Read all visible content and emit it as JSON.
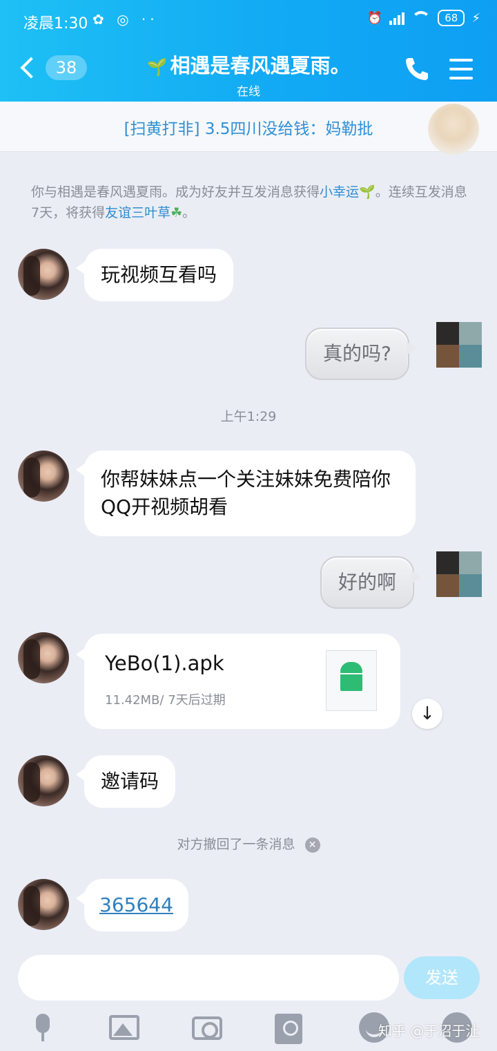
{
  "status_bar": {
    "time": "凌晨1:30",
    "left_icons": "✿ ◎ ··",
    "battery": "68",
    "charging": "⚡"
  },
  "header": {
    "back_count": "38",
    "title_icon": "🌱",
    "title": "相遇是春风遇夏雨。",
    "subtitle": "在线"
  },
  "banner": {
    "text": "[扫黄打非] 3.5四川没给钱：妈勒批"
  },
  "system_notice": {
    "part1": "你与相遇是春风遇夏雨。成为好友并互发消息获得",
    "link1": "小幸运",
    "icon1": "🌱",
    "part2": "。连续互发消息7天，将获得",
    "link2": "友谊三叶草",
    "icon2": "☘",
    "part3": "。"
  },
  "messages": [
    {
      "from": "other",
      "text": "玩视频互看吗"
    },
    {
      "from": "self",
      "text": "真的吗?"
    },
    {
      "from": "time",
      "text": "上午1:29"
    },
    {
      "from": "other",
      "text": "你帮妹妹点一个关注妹妹免费陪你QQ开视频胡看"
    },
    {
      "from": "self",
      "text": "好的啊"
    },
    {
      "from": "other",
      "type": "file",
      "file_name": "YeBo(1).apk",
      "file_meta": "11.42MB/ 7天后过期"
    },
    {
      "from": "other",
      "text": "邀请码"
    },
    {
      "from": "system",
      "text": "对方撤回了一条消息"
    },
    {
      "from": "other",
      "text": "365644"
    }
  ],
  "input": {
    "placeholder": "",
    "send_label": "发送"
  },
  "watermark": "知乎 @于沼于沚",
  "colors": {
    "header_start": "#1ec0f5",
    "header_end": "#0e9ff3",
    "link": "#2e8ccf",
    "send_button": "#b2e6fb"
  }
}
